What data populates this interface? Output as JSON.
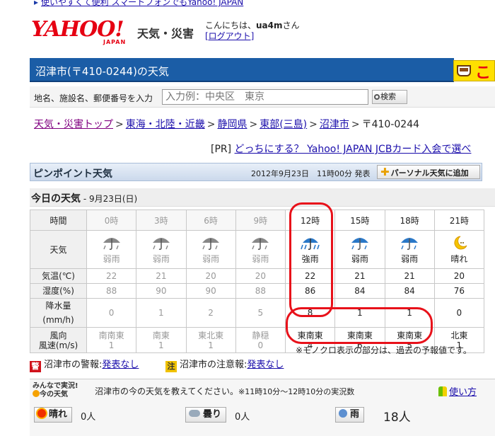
{
  "promo": {
    "text": "使いやすくて便利 スマートフォンでもYahoo! JAPAN"
  },
  "header": {
    "logo_text": "YAHOO!",
    "logo_sub": "JAPAN",
    "service_name": "天気・災害",
    "greeting": "こんにちは、",
    "username": "ua4m",
    "honorific": "さん",
    "logout": "[ログアウト]"
  },
  "title": "沼津市(〒410-0244)の天気",
  "banner_text": "こ",
  "search": {
    "label": "地名、施設名、郵便番号を入力",
    "placeholder": "入力例：中央区　東京",
    "button": "検索"
  },
  "breadcrumb": {
    "items": [
      "天気・災害トップ",
      "東海・北陸・近畿",
      "静岡県",
      "東部(三島)",
      "沼津市"
    ],
    "current": "〒410-0244",
    "separator": ">"
  },
  "pr": {
    "tag": "[PR]",
    "link": "どっちにする？ Yahoo! JAPAN JCBカード入会で選べ"
  },
  "pinpoint": {
    "title": "ピンポイント天気",
    "announced": "2012年9月23日　11時00分 発表",
    "add_button": "パーソナル天気に追加"
  },
  "today": {
    "title": "今日の天気",
    "date": " - 9月23日(日)"
  },
  "table": {
    "row_labels": {
      "time": "時間",
      "weather": "天気",
      "temp": "気温(℃)",
      "humidity": "湿度(%)",
      "precip": "降水量(mm/h)",
      "wind_dir": "風向",
      "wind_speed": "風速(m/s)"
    },
    "columns": [
      {
        "time": "0時",
        "weather": "弱雨",
        "temp": "22",
        "humidity": "88",
        "precip": "0",
        "wind_dir": "南南東",
        "wind_speed": "1",
        "past": true,
        "icon": "umbrella-icon"
      },
      {
        "time": "3時",
        "weather": "弱雨",
        "temp": "21",
        "humidity": "90",
        "precip": "1",
        "wind_dir": "南東",
        "wind_speed": "1",
        "past": true,
        "icon": "umbrella-icon"
      },
      {
        "time": "6時",
        "weather": "弱雨",
        "temp": "20",
        "humidity": "90",
        "precip": "2",
        "wind_dir": "東北東",
        "wind_speed": "1",
        "past": true,
        "icon": "umbrella-icon"
      },
      {
        "time": "9時",
        "weather": "弱雨",
        "temp": "20",
        "humidity": "88",
        "precip": "5",
        "wind_dir": "静穏",
        "wind_speed": "0",
        "past": true,
        "icon": "umbrella-icon"
      },
      {
        "time": "12時",
        "weather": "強雨",
        "temp": "22",
        "humidity": "86",
        "precip": "8",
        "wind_dir": "東南東",
        "wind_speed": "4",
        "past": false,
        "icon": "heavy-rain-icon"
      },
      {
        "time": "15時",
        "weather": "弱雨",
        "temp": "21",
        "humidity": "84",
        "precip": "1",
        "wind_dir": "東南東",
        "wind_speed": "6",
        "past": false,
        "icon": "umbrella-icon"
      },
      {
        "time": "18時",
        "weather": "弱雨",
        "temp": "21",
        "humidity": "84",
        "precip": "1",
        "wind_dir": "東南東",
        "wind_speed": "5",
        "past": false,
        "icon": "umbrella-icon"
      },
      {
        "time": "21時",
        "weather": "晴れ",
        "temp": "20",
        "humidity": "76",
        "precip": "0",
        "wind_dir": "北東",
        "wind_speed": "1",
        "past": false,
        "icon": "moon-icon"
      }
    ]
  },
  "note": "※モノクロ表示の部分は、過去の予報値です。",
  "warnings": {
    "warning_badge": "警",
    "warning_label": "沼津市の警報:",
    "warning_value": "発表なし",
    "advisory_badge": "注",
    "advisory_label": "沼津市の注意報:",
    "advisory_value": "発表なし"
  },
  "community": {
    "logo_line1": "みんなで実況!",
    "logo_line2": "今の天気",
    "prompt": "沼津市の今の天気を教えてください。",
    "period": "※11時10分～12時10分の実況数",
    "howto": "使い方",
    "votes": [
      {
        "label": "晴れ",
        "count": "0人"
      },
      {
        "label": "曇り",
        "count": "0人"
      },
      {
        "label": "雨",
        "count": "18人"
      }
    ]
  },
  "colors": {
    "title_bar": "#1b5da6",
    "annotation": "#e8111a",
    "logo": "#e60012"
  }
}
